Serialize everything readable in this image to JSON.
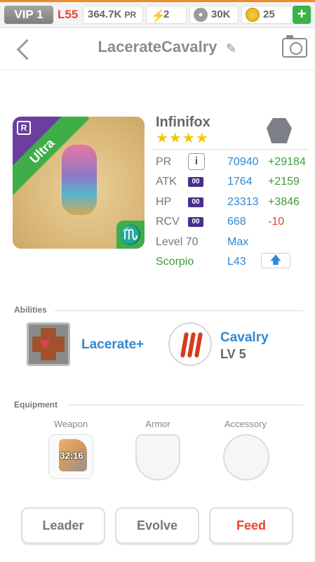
{
  "status_bar": {
    "vip": "VIP 1",
    "level": "L55",
    "pr_value": "364.7K",
    "pr_unit": "PR",
    "energy": "2",
    "paw_count": "30K",
    "coins": "25",
    "plus": "+"
  },
  "header": {
    "title": "LacerateCavalry",
    "edit_glyph": "✎"
  },
  "monster": {
    "name": "Infinifox",
    "stars": "★★★★",
    "rarity": "Ultra",
    "rarity_icon": "R",
    "zodiac_glyph": "♏",
    "colors": {
      "rarity_ribbon": "#3fae49",
      "corner": "#6a3fa0"
    }
  },
  "stats": {
    "pr": {
      "label": "PR",
      "info": "i",
      "value": "70940",
      "delta": "+29184"
    },
    "atk": {
      "label": "ATK",
      "badge": "00",
      "value": "1764",
      "delta": "+2159"
    },
    "hp": {
      "label": "HP",
      "badge": "00",
      "value": "23313",
      "delta": "+3846"
    },
    "rcv": {
      "label": "RCV",
      "badge": "00",
      "value": "668",
      "delta": "-10"
    },
    "level": {
      "label": "Level 70",
      "value": "Max"
    },
    "zodiac": {
      "label": "Scorpio",
      "value": "L43",
      "upgrade_glyph": "🡅"
    }
  },
  "abilities": {
    "section_label": "Abilities",
    "items": [
      {
        "name": "Lacerate+",
        "icon": "cross-heart-icon"
      },
      {
        "name": "Cavalry",
        "level": "LV 5",
        "icon": "claw-marks-icon"
      }
    ]
  },
  "equipment": {
    "section_label": "Equipment",
    "weapon_label": "Weapon",
    "armor_label": "Armor",
    "accessory_label": "Accessory",
    "weapon_timer": "32:16"
  },
  "actions": {
    "leader": "Leader",
    "evolve": "Evolve",
    "feed": "Feed"
  }
}
